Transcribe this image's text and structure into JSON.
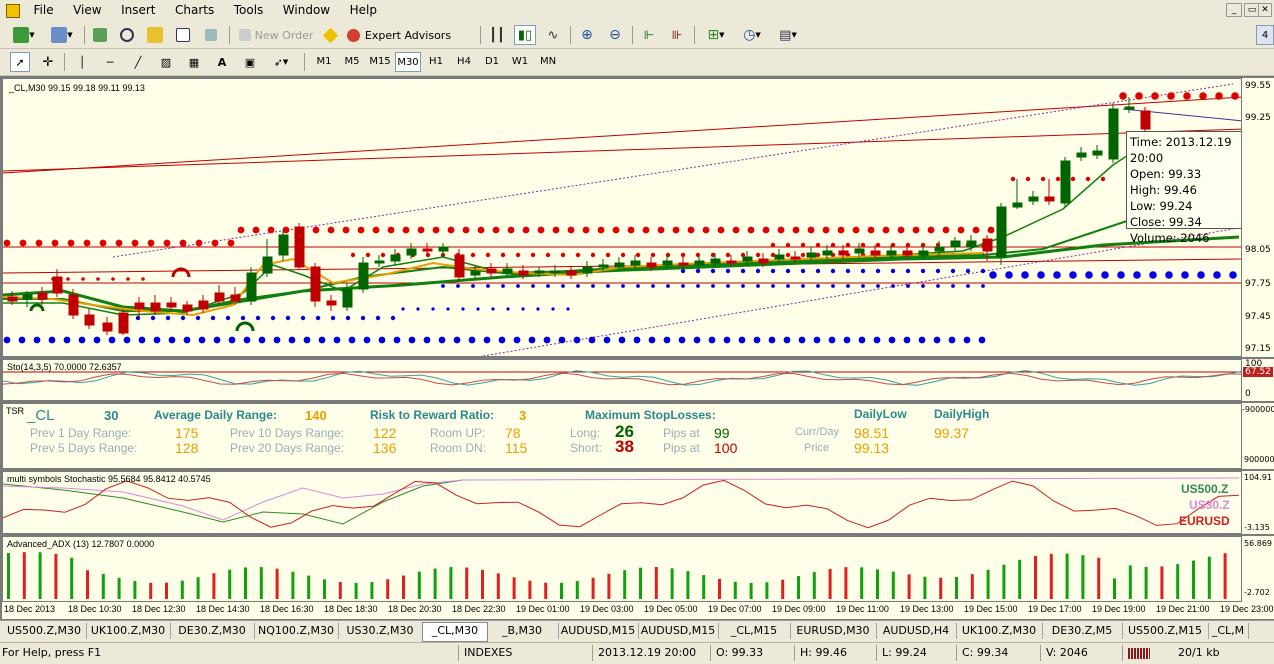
{
  "menu": [
    "File",
    "View",
    "Insert",
    "Charts",
    "Tools",
    "Window",
    "Help"
  ],
  "toolbar": {
    "new_order": "New Order",
    "expert_advisors": "Expert Advisors"
  },
  "timeframes": [
    "M1",
    "M5",
    "M15",
    "M30",
    "H1",
    "H4",
    "D1",
    "W1",
    "MN"
  ],
  "active_timeframe": "M30",
  "main_chart": {
    "header": "_CL,M30  99.15 99.18 99.11 99.13",
    "price_labels": [
      "99.55",
      "99.25",
      "98.05",
      "97.75",
      "97.45",
      "97.15"
    ],
    "tooltip": [
      "Time: 2013.12.19 20:00",
      "Open: 99.33",
      "High: 99.46",
      "Low:  99.24",
      "Close: 99.34",
      "Volume: 2046"
    ]
  },
  "stoch": {
    "header": "Sto(14,3,5) 70.0000 72.6357",
    "axis": [
      "100",
      "67.52",
      "0"
    ]
  },
  "tsr": {
    "symbol": "_CL",
    "period": "30",
    "adr_label": "Average Daily Range:",
    "adr_value": "140",
    "rr_label": "Risk to Reward Ratio:",
    "rr_value": "3",
    "msl_label": "Maximum StopLosses:",
    "prev1_label": "Prev 1 Day Range:",
    "prev1_value": "175",
    "prev5_label": "Prev 5 Days Range:",
    "prev5_value": "128",
    "prev10_label": "Prev 10 Days Range:",
    "prev10_value": "122",
    "prev20_label": "Prev 20 Days Range:",
    "prev20_value": "136",
    "roomup_label": "Room UP:",
    "roomup_value": "78",
    "roomdn_label": "Room DN:",
    "roomdn_value": "115",
    "long_label": "Long:",
    "long_value": "26",
    "short_label": "Short:",
    "short_value": "38",
    "pips_label": "Pips at",
    "pips_long": "99",
    "pips_short": "100",
    "daily_low_label": "DailyLow",
    "daily_high_label": "DailyHigh",
    "currday_label": "Curr/Day",
    "price_label": "Price",
    "daily_low_value": "98.51",
    "daily_high_value": "99.37",
    "price_value": "99.13",
    "axis": [
      "-900000",
      "900000"
    ]
  },
  "multi": {
    "header": "multi symbols Stochastic 95.5684 95.8412 40.5745",
    "legend": [
      {
        "name": "US500.Z",
        "color": "#2e8b57"
      },
      {
        "name": "US30.Z",
        "color": "#dd88dd"
      },
      {
        "name": "EURUSD",
        "color": "#cc2020"
      }
    ],
    "axis": [
      "104.91",
      "-3.135"
    ]
  },
  "adx": {
    "header": "Advanced_ADX (13) 12.7807 0.0000",
    "axis": [
      "56.869",
      "-2.702"
    ]
  },
  "time_axis": [
    "18 Dec 2013",
    "18 Dec 10:30",
    "18 Dec 12:30",
    "18 Dec 14:30",
    "18 Dec 16:30",
    "18 Dec 18:30",
    "18 Dec 20:30",
    "18 Dec 22:30",
    "19 Dec 01:00",
    "19 Dec 03:00",
    "19 Dec 05:00",
    "19 Dec 07:00",
    "19 Dec 09:00",
    "19 Dec 11:00",
    "19 Dec 13:00",
    "19 Dec 15:00",
    "19 Dec 17:00",
    "19 Dec 19:00",
    "19 Dec 21:00",
    "19 Dec 23:00"
  ],
  "tabs": [
    "US500.Z,M30",
    "UK100.Z,M30",
    "DE30.Z,M30",
    "NQ100.Z,M30",
    "US30.Z,M30",
    "_CL,M30",
    "_B,M30",
    "AUDUSD,M15",
    "AUDUSD,M15",
    "_CL,M15",
    "EURUSD,M30",
    "AUDUSD,H4",
    "UK100.Z,M30",
    "DE30.Z,M5",
    "US500.Z,M15",
    "_CL,M"
  ],
  "active_tab": "_CL,M30",
  "status": {
    "help": "For Help, press F1",
    "profile": "INDEXES",
    "datetime": "2013.12.19 20:00",
    "open": "O: 99.33",
    "high": "H: 99.46",
    "low": "L: 99.24",
    "close": "C: 99.34",
    "volume": "V: 2046",
    "traffic": "20/1 kb"
  },
  "colors": {
    "bull": "#006400",
    "bear": "#c00000",
    "red_dot": "#e00000",
    "blue_dot": "#0000e0",
    "bg": "#fffee8"
  }
}
